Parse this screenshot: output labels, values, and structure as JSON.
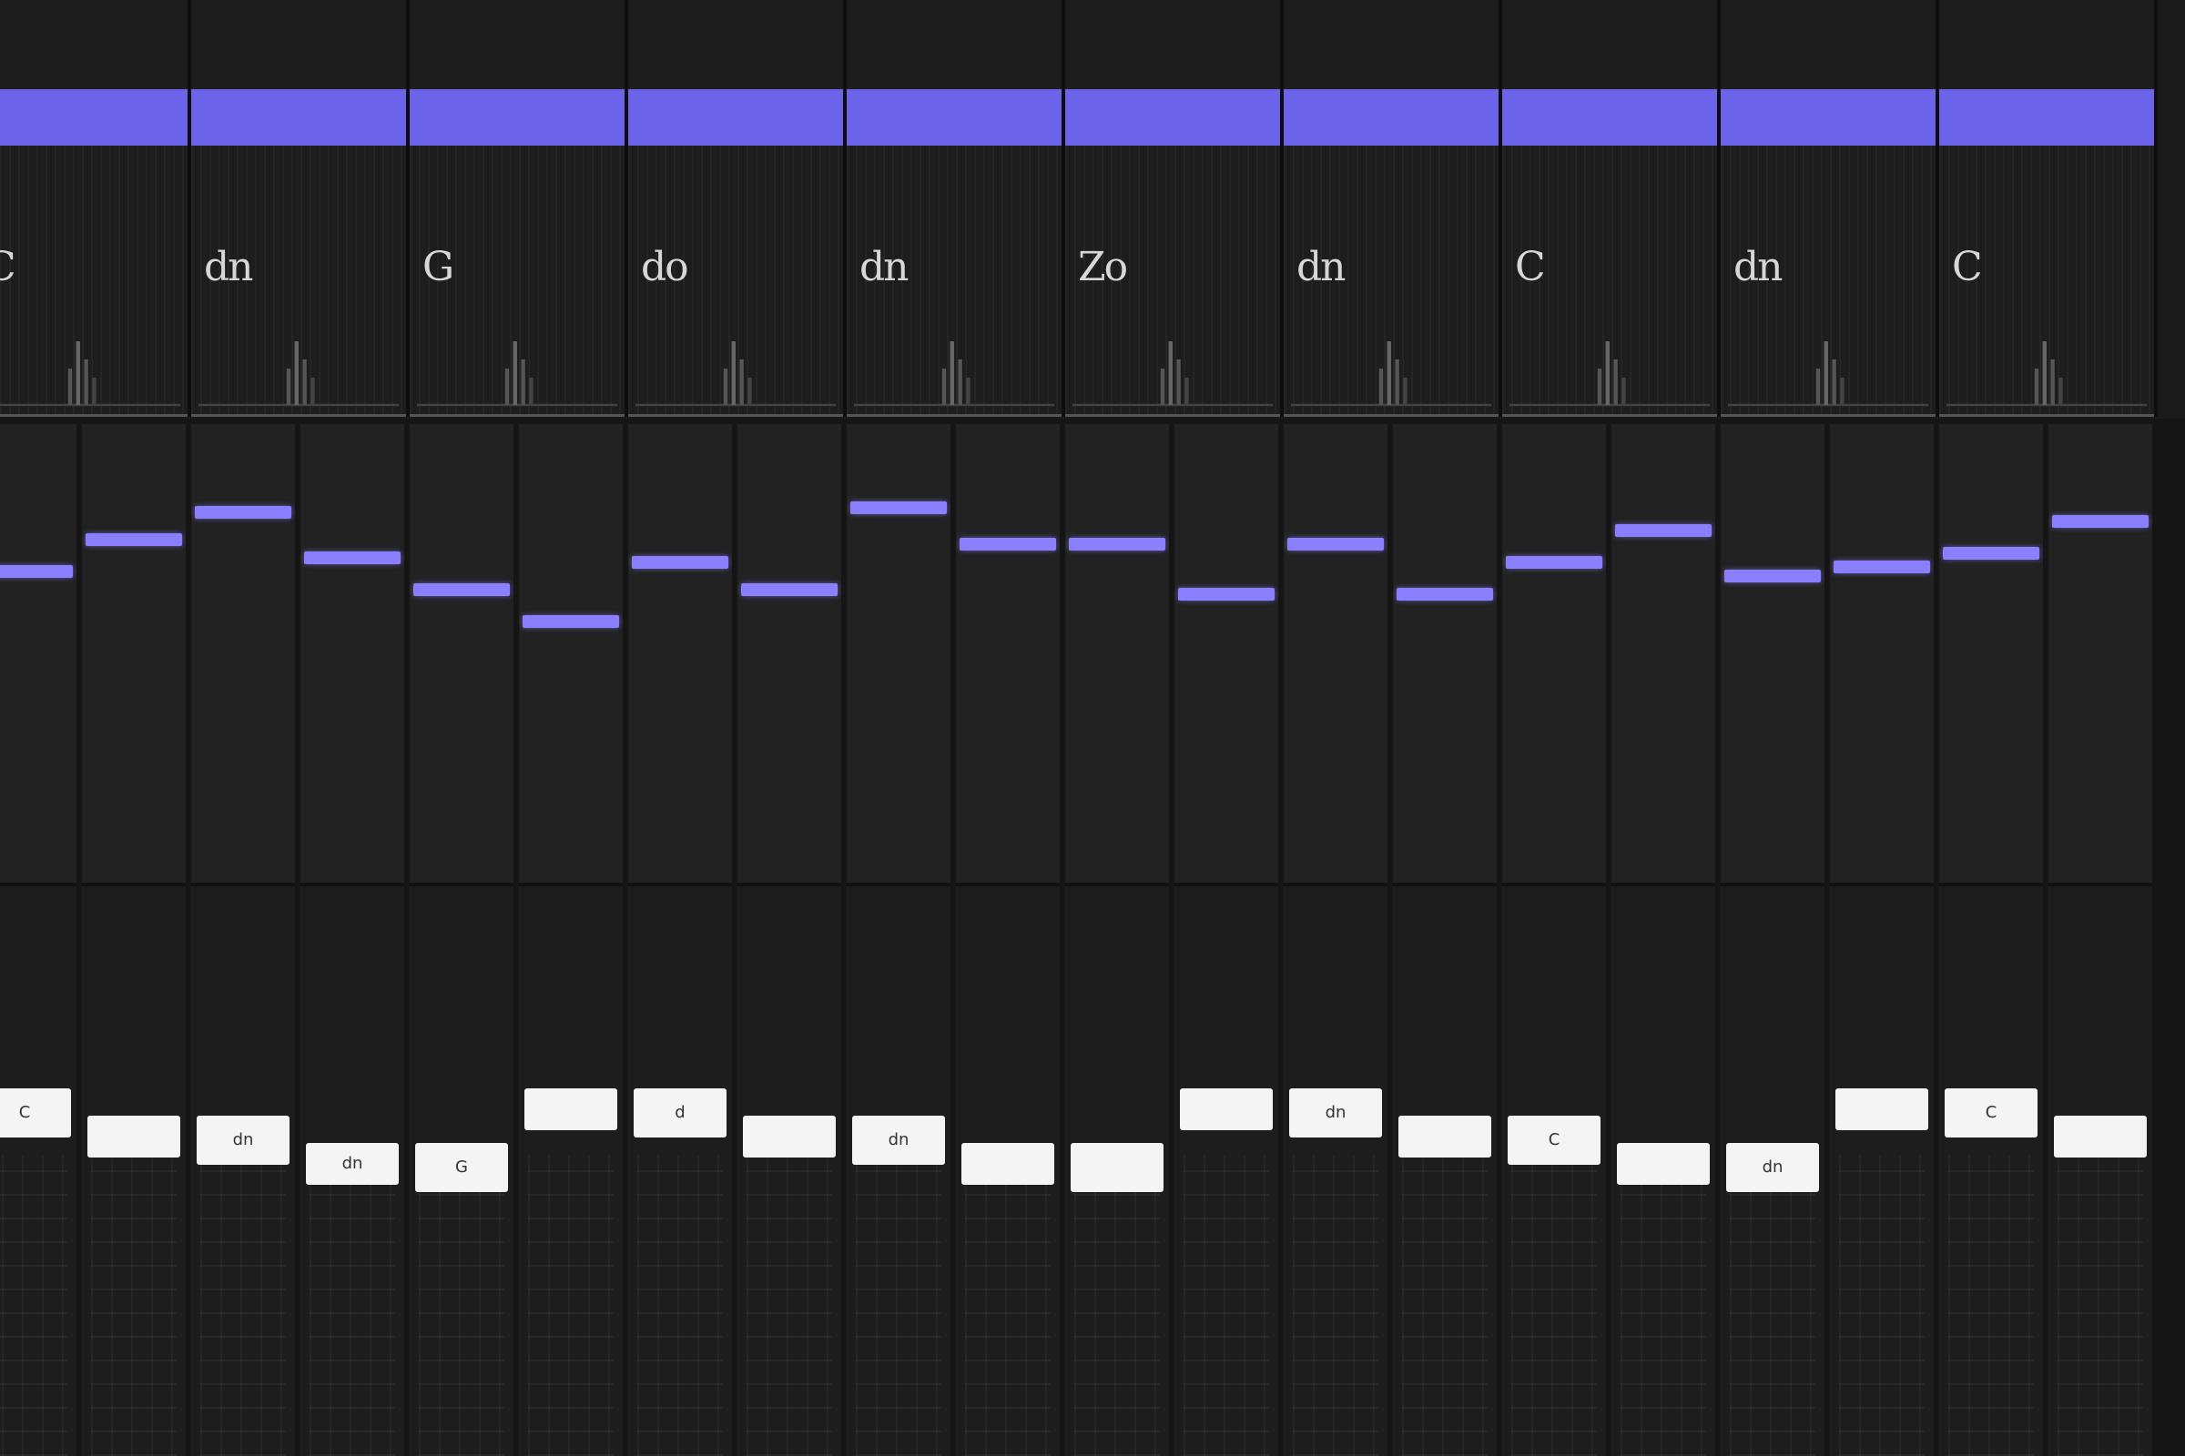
{
  "theme": {
    "accent": "#6d63e8",
    "note_color": "#8a80ff",
    "background": "#151515",
    "lane": "#222222",
    "label_bg": "#f4f4f4"
  },
  "columns": [
    {
      "chord": "C",
      "lanes": [
        {
          "note_level": 0.77,
          "tag": "C"
        },
        {
          "note_level": 0.84,
          "tag": ""
        }
      ]
    },
    {
      "chord": "dn",
      "lanes": [
        {
          "note_level": 0.9,
          "tag": "dn"
        },
        {
          "note_level": 0.8,
          "tag": "dn"
        }
      ]
    },
    {
      "chord": "G",
      "lanes": [
        {
          "note_level": 0.73,
          "tag": "G"
        },
        {
          "note_level": 0.66,
          "tag": ""
        }
      ]
    },
    {
      "chord": "do",
      "lanes": [
        {
          "note_level": 0.79,
          "tag": "d"
        },
        {
          "note_level": 0.73,
          "tag": ""
        }
      ]
    },
    {
      "chord": "dn",
      "lanes": [
        {
          "note_level": 0.91,
          "tag": "dn"
        },
        {
          "note_level": 0.83,
          "tag": ""
        }
      ]
    },
    {
      "chord": "Zo",
      "lanes": [
        {
          "note_level": 0.83,
          "tag": ""
        },
        {
          "note_level": 0.72,
          "tag": ""
        }
      ]
    },
    {
      "chord": "dn",
      "lanes": [
        {
          "note_level": 0.83,
          "tag": "dn"
        },
        {
          "note_level": 0.72,
          "tag": ""
        }
      ]
    },
    {
      "chord": "C",
      "lanes": [
        {
          "note_level": 0.79,
          "tag": "C"
        },
        {
          "note_level": 0.86,
          "tag": ""
        }
      ]
    },
    {
      "chord": "dn",
      "lanes": [
        {
          "note_level": 0.76,
          "tag": "dn"
        },
        {
          "note_level": 0.78,
          "tag": ""
        }
      ]
    },
    {
      "chord": "C",
      "lanes": [
        {
          "note_level": 0.81,
          "tag": "C"
        },
        {
          "note_level": 0.88,
          "tag": ""
        }
      ]
    }
  ]
}
